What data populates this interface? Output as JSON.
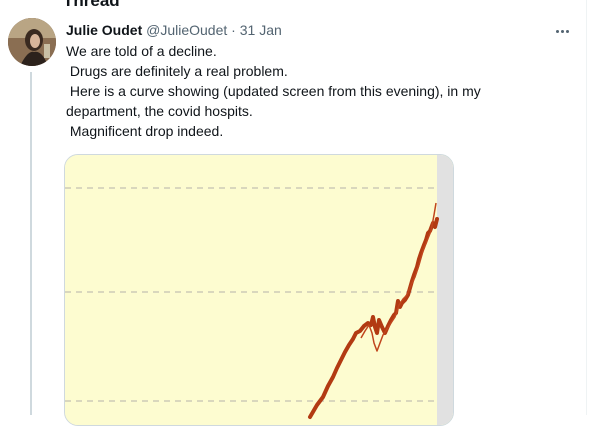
{
  "page": {
    "section_title": "Thread"
  },
  "tweet": {
    "author_name": "Julie Oudet",
    "author_handle": "@JulieOudet",
    "separator": "·",
    "date": "31 Jan",
    "text_lines": [
      "We are told of a decline.",
      " Drugs are definitely a real problem.",
      " Here is a curve showing (updated screen from this evening), in my",
      "department, the covid hospits.",
      " Magnificent drop indeed."
    ],
    "more_icon": "more-horizontal-icon",
    "avatar_icon": "profile-photo"
  },
  "media": {
    "background": "#fdfcd0",
    "line_color": "#b23a12"
  }
}
